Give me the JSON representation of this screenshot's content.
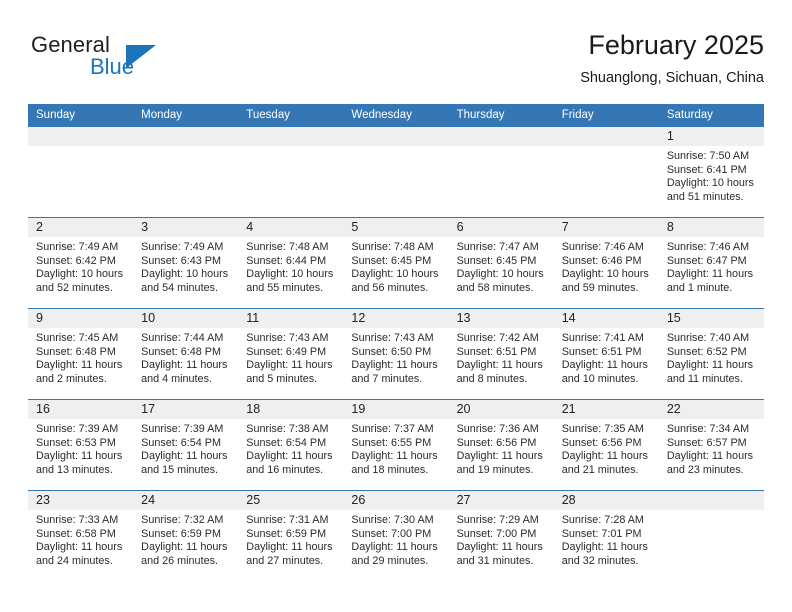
{
  "brand": {
    "name_part1": "General",
    "name_part2": "Blue",
    "flag_icon": "flag-triangle-icon"
  },
  "header": {
    "month_title": "February 2025",
    "location": "Shuanglong, Sichuan, China"
  },
  "theme": {
    "header_blue": "#3577b5",
    "brand_blue": "#1b75bb",
    "daynum_band": "#efefef",
    "text": "#222222"
  },
  "calendar": {
    "weekday_headers": [
      "Sunday",
      "Monday",
      "Tuesday",
      "Wednesday",
      "Thursday",
      "Friday",
      "Saturday"
    ],
    "weeks": [
      [
        {
          "day": "",
          "sunrise": "",
          "sunset": "",
          "daylight_line1": "",
          "daylight_line2": "",
          "empty": true
        },
        {
          "day": "",
          "sunrise": "",
          "sunset": "",
          "daylight_line1": "",
          "daylight_line2": "",
          "empty": true
        },
        {
          "day": "",
          "sunrise": "",
          "sunset": "",
          "daylight_line1": "",
          "daylight_line2": "",
          "empty": true
        },
        {
          "day": "",
          "sunrise": "",
          "sunset": "",
          "daylight_line1": "",
          "daylight_line2": "",
          "empty": true
        },
        {
          "day": "",
          "sunrise": "",
          "sunset": "",
          "daylight_line1": "",
          "daylight_line2": "",
          "empty": true
        },
        {
          "day": "",
          "sunrise": "",
          "sunset": "",
          "daylight_line1": "",
          "daylight_line2": "",
          "empty": true
        },
        {
          "day": "1",
          "sunrise": "Sunrise: 7:50 AM",
          "sunset": "Sunset: 6:41 PM",
          "daylight_line1": "Daylight: 10 hours",
          "daylight_line2": "and 51 minutes.",
          "empty": false
        }
      ],
      [
        {
          "day": "2",
          "sunrise": "Sunrise: 7:49 AM",
          "sunset": "Sunset: 6:42 PM",
          "daylight_line1": "Daylight: 10 hours",
          "daylight_line2": "and 52 minutes.",
          "empty": false
        },
        {
          "day": "3",
          "sunrise": "Sunrise: 7:49 AM",
          "sunset": "Sunset: 6:43 PM",
          "daylight_line1": "Daylight: 10 hours",
          "daylight_line2": "and 54 minutes.",
          "empty": false
        },
        {
          "day": "4",
          "sunrise": "Sunrise: 7:48 AM",
          "sunset": "Sunset: 6:44 PM",
          "daylight_line1": "Daylight: 10 hours",
          "daylight_line2": "and 55 minutes.",
          "empty": false
        },
        {
          "day": "5",
          "sunrise": "Sunrise: 7:48 AM",
          "sunset": "Sunset: 6:45 PM",
          "daylight_line1": "Daylight: 10 hours",
          "daylight_line2": "and 56 minutes.",
          "empty": false
        },
        {
          "day": "6",
          "sunrise": "Sunrise: 7:47 AM",
          "sunset": "Sunset: 6:45 PM",
          "daylight_line1": "Daylight: 10 hours",
          "daylight_line2": "and 58 minutes.",
          "empty": false
        },
        {
          "day": "7",
          "sunrise": "Sunrise: 7:46 AM",
          "sunset": "Sunset: 6:46 PM",
          "daylight_line1": "Daylight: 10 hours",
          "daylight_line2": "and 59 minutes.",
          "empty": false
        },
        {
          "day": "8",
          "sunrise": "Sunrise: 7:46 AM",
          "sunset": "Sunset: 6:47 PM",
          "daylight_line1": "Daylight: 11 hours",
          "daylight_line2": "and 1 minute.",
          "empty": false
        }
      ],
      [
        {
          "day": "9",
          "sunrise": "Sunrise: 7:45 AM",
          "sunset": "Sunset: 6:48 PM",
          "daylight_line1": "Daylight: 11 hours",
          "daylight_line2": "and 2 minutes.",
          "empty": false
        },
        {
          "day": "10",
          "sunrise": "Sunrise: 7:44 AM",
          "sunset": "Sunset: 6:48 PM",
          "daylight_line1": "Daylight: 11 hours",
          "daylight_line2": "and 4 minutes.",
          "empty": false
        },
        {
          "day": "11",
          "sunrise": "Sunrise: 7:43 AM",
          "sunset": "Sunset: 6:49 PM",
          "daylight_line1": "Daylight: 11 hours",
          "daylight_line2": "and 5 minutes.",
          "empty": false
        },
        {
          "day": "12",
          "sunrise": "Sunrise: 7:43 AM",
          "sunset": "Sunset: 6:50 PM",
          "daylight_line1": "Daylight: 11 hours",
          "daylight_line2": "and 7 minutes.",
          "empty": false
        },
        {
          "day": "13",
          "sunrise": "Sunrise: 7:42 AM",
          "sunset": "Sunset: 6:51 PM",
          "daylight_line1": "Daylight: 11 hours",
          "daylight_line2": "and 8 minutes.",
          "empty": false
        },
        {
          "day": "14",
          "sunrise": "Sunrise: 7:41 AM",
          "sunset": "Sunset: 6:51 PM",
          "daylight_line1": "Daylight: 11 hours",
          "daylight_line2": "and 10 minutes.",
          "empty": false
        },
        {
          "day": "15",
          "sunrise": "Sunrise: 7:40 AM",
          "sunset": "Sunset: 6:52 PM",
          "daylight_line1": "Daylight: 11 hours",
          "daylight_line2": "and 11 minutes.",
          "empty": false
        }
      ],
      [
        {
          "day": "16",
          "sunrise": "Sunrise: 7:39 AM",
          "sunset": "Sunset: 6:53 PM",
          "daylight_line1": "Daylight: 11 hours",
          "daylight_line2": "and 13 minutes.",
          "empty": false
        },
        {
          "day": "17",
          "sunrise": "Sunrise: 7:39 AM",
          "sunset": "Sunset: 6:54 PM",
          "daylight_line1": "Daylight: 11 hours",
          "daylight_line2": "and 15 minutes.",
          "empty": false
        },
        {
          "day": "18",
          "sunrise": "Sunrise: 7:38 AM",
          "sunset": "Sunset: 6:54 PM",
          "daylight_line1": "Daylight: 11 hours",
          "daylight_line2": "and 16 minutes.",
          "empty": false
        },
        {
          "day": "19",
          "sunrise": "Sunrise: 7:37 AM",
          "sunset": "Sunset: 6:55 PM",
          "daylight_line1": "Daylight: 11 hours",
          "daylight_line2": "and 18 minutes.",
          "empty": false
        },
        {
          "day": "20",
          "sunrise": "Sunrise: 7:36 AM",
          "sunset": "Sunset: 6:56 PM",
          "daylight_line1": "Daylight: 11 hours",
          "daylight_line2": "and 19 minutes.",
          "empty": false
        },
        {
          "day": "21",
          "sunrise": "Sunrise: 7:35 AM",
          "sunset": "Sunset: 6:56 PM",
          "daylight_line1": "Daylight: 11 hours",
          "daylight_line2": "and 21 minutes.",
          "empty": false
        },
        {
          "day": "22",
          "sunrise": "Sunrise: 7:34 AM",
          "sunset": "Sunset: 6:57 PM",
          "daylight_line1": "Daylight: 11 hours",
          "daylight_line2": "and 23 minutes.",
          "empty": false
        }
      ],
      [
        {
          "day": "23",
          "sunrise": "Sunrise: 7:33 AM",
          "sunset": "Sunset: 6:58 PM",
          "daylight_line1": "Daylight: 11 hours",
          "daylight_line2": "and 24 minutes.",
          "empty": false
        },
        {
          "day": "24",
          "sunrise": "Sunrise: 7:32 AM",
          "sunset": "Sunset: 6:59 PM",
          "daylight_line1": "Daylight: 11 hours",
          "daylight_line2": "and 26 minutes.",
          "empty": false
        },
        {
          "day": "25",
          "sunrise": "Sunrise: 7:31 AM",
          "sunset": "Sunset: 6:59 PM",
          "daylight_line1": "Daylight: 11 hours",
          "daylight_line2": "and 27 minutes.",
          "empty": false
        },
        {
          "day": "26",
          "sunrise": "Sunrise: 7:30 AM",
          "sunset": "Sunset: 7:00 PM",
          "daylight_line1": "Daylight: 11 hours",
          "daylight_line2": "and 29 minutes.",
          "empty": false
        },
        {
          "day": "27",
          "sunrise": "Sunrise: 7:29 AM",
          "sunset": "Sunset: 7:00 PM",
          "daylight_line1": "Daylight: 11 hours",
          "daylight_line2": "and 31 minutes.",
          "empty": false
        },
        {
          "day": "28",
          "sunrise": "Sunrise: 7:28 AM",
          "sunset": "Sunset: 7:01 PM",
          "daylight_line1": "Daylight: 11 hours",
          "daylight_line2": "and 32 minutes.",
          "empty": false
        },
        {
          "day": "",
          "sunrise": "",
          "sunset": "",
          "daylight_line1": "",
          "daylight_line2": "",
          "empty": true
        }
      ]
    ]
  }
}
